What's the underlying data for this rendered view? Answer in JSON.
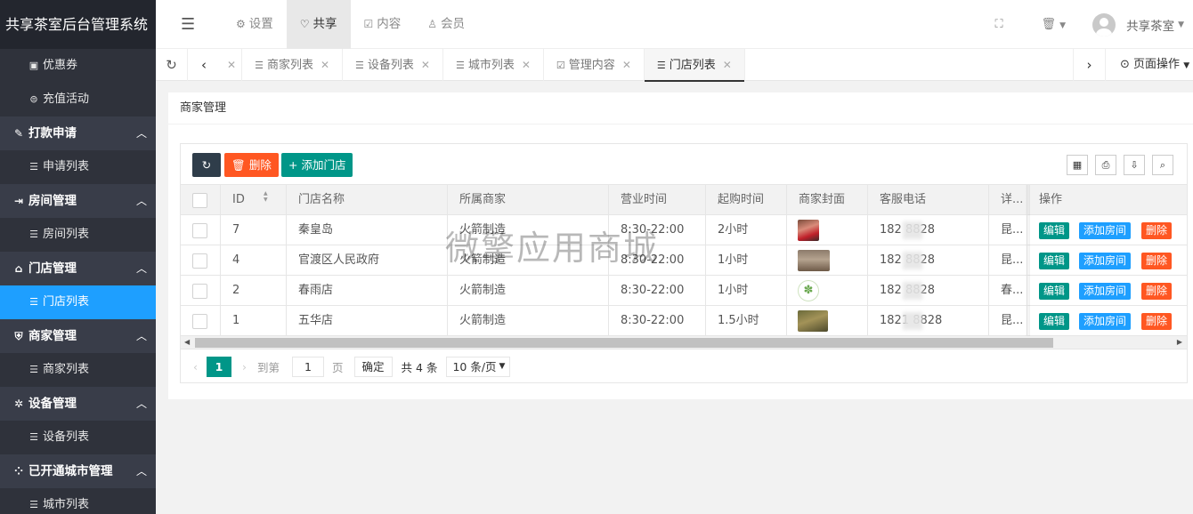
{
  "app": {
    "title": "共享茶室后台管理系统"
  },
  "sidebar": {
    "items": [
      {
        "type": "item",
        "label": "优惠券",
        "icon": "coupon-icon",
        "glyph": "▣",
        "name": "sidebar-item-coupons"
      },
      {
        "type": "item",
        "label": "充值活动",
        "icon": "recharge-icon",
        "glyph": "⊜",
        "name": "sidebar-item-recharge"
      },
      {
        "type": "group",
        "label": "打款申请",
        "icon": "edit-icon",
        "glyph": "✎",
        "name": "sidebar-group-payout"
      },
      {
        "type": "item",
        "label": "申请列表",
        "icon": "list-icon",
        "glyph": "☰",
        "name": "sidebar-item-payout-list"
      },
      {
        "type": "group",
        "label": "房间管理",
        "icon": "login-icon",
        "glyph": "⇥",
        "name": "sidebar-group-rooms"
      },
      {
        "type": "item",
        "label": "房间列表",
        "icon": "list-icon",
        "glyph": "☰",
        "name": "sidebar-item-room-list"
      },
      {
        "type": "group",
        "label": "门店管理",
        "icon": "home-icon",
        "glyph": "⌂",
        "name": "sidebar-group-stores"
      },
      {
        "type": "item",
        "label": "门店列表",
        "icon": "list-icon",
        "glyph": "☰",
        "name": "sidebar-item-store-list",
        "active": true
      },
      {
        "type": "group",
        "label": "商家管理",
        "icon": "shield-icon",
        "glyph": "⛨",
        "name": "sidebar-group-merchants"
      },
      {
        "type": "item",
        "label": "商家列表",
        "icon": "list-icon",
        "glyph": "☰",
        "name": "sidebar-item-merchant-list"
      },
      {
        "type": "group",
        "label": "设备管理",
        "icon": "gear-icon",
        "glyph": "✲",
        "name": "sidebar-group-devices"
      },
      {
        "type": "item",
        "label": "设备列表",
        "icon": "list-icon",
        "glyph": "☰",
        "name": "sidebar-item-device-list"
      },
      {
        "type": "group",
        "label": "已开通城市管理",
        "icon": "apps-icon",
        "glyph": "⁘",
        "name": "sidebar-group-cities"
      },
      {
        "type": "item",
        "label": "城市列表",
        "icon": "list-icon",
        "glyph": "☰",
        "name": "sidebar-item-city-list"
      }
    ]
  },
  "header": {
    "nav": [
      {
        "label": "设置",
        "icon": "gear-icon",
        "glyph": "⚙"
      },
      {
        "label": "共享",
        "icon": "heart-icon",
        "glyph": "♡",
        "active": true
      },
      {
        "label": "内容",
        "icon": "edit-icon",
        "glyph": "☑"
      },
      {
        "label": "会员",
        "icon": "user-icon",
        "glyph": "♙"
      }
    ],
    "user_name": "共享茶室"
  },
  "tabs": {
    "items": [
      {
        "label": "商家列表"
      },
      {
        "label": "设备列表"
      },
      {
        "label": "城市列表"
      },
      {
        "label": "管理内容",
        "glyph": "☑"
      },
      {
        "label": "门店列表",
        "active": true
      }
    ],
    "page_ops_label": "页面操作"
  },
  "card": {
    "title": "商家管理"
  },
  "toolbar": {
    "delete_label": "删除",
    "add_label": "添加门店"
  },
  "table": {
    "columns": [
      "ID",
      "门店名称",
      "所属商家",
      "营业时间",
      "起购时间",
      "商家封面",
      "客服电话",
      "详...",
      "操作"
    ],
    "rows": [
      {
        "id": "7",
        "name": "秦皇岛",
        "merchant": "火箭制造",
        "hours": "8:30-22:00",
        "min": "2小时",
        "cover": "person",
        "phone": "182  8828",
        "detail": "昆...",
        "edit": "编辑",
        "add_room": "添加房间",
        "del": "删除"
      },
      {
        "id": "4",
        "name": "官渡区人民政府",
        "merchant": "火箭制造",
        "hours": "8:30-22:00",
        "min": "1小时",
        "cover": "room",
        "phone": "182  8828",
        "detail": "昆...",
        "edit": "编辑",
        "add_room": "添加房间",
        "del": "删除"
      },
      {
        "id": "2",
        "name": "春雨店",
        "merchant": "火箭制造",
        "hours": "8:30-22:00",
        "min": "1小时",
        "cover": "logo",
        "phone": "182  8828",
        "detail": "春...",
        "edit": "编辑",
        "add_room": "添加房间",
        "del": "删除"
      },
      {
        "id": "1",
        "name": "五华店",
        "merchant": "火箭制造",
        "hours": "8:30-22:00",
        "min": "1.5小时",
        "cover": "soldier",
        "phone": "1821  8828",
        "detail": "昆...",
        "edit": "编辑",
        "add_room": "添加房间",
        "del": "删除"
      }
    ]
  },
  "pager": {
    "current": "1",
    "goto_label": "到第",
    "page_input": "1",
    "page_unit": "页",
    "confirm": "确定",
    "total": "共 4 条",
    "page_size": "10 条/页"
  },
  "watermark": "微擎应用商城"
}
